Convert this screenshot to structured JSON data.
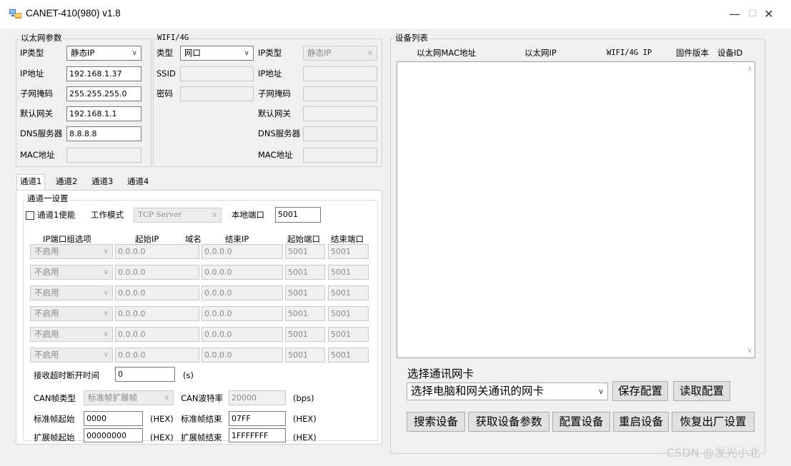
{
  "window": {
    "title": "CANET-410(980) v1.8",
    "min": "—",
    "max": "☐",
    "close": "✕"
  },
  "ethernet": {
    "group_label": "以太网参数",
    "ip_type_label": "IP类型",
    "ip_type_value": "静态IP",
    "ip_label": "IP地址",
    "ip_value": "192.168.1.37",
    "mask_label": "子网掩码",
    "mask_value": "255.255.255.0",
    "gateway_label": "默认网关",
    "gateway_value": "192.168.1.1",
    "dns_label": "DNS服务器",
    "dns_value": "8.8.8.8",
    "mac_label": "MAC地址",
    "mac_value": ""
  },
  "wifi": {
    "group_label": "WIFI/4G",
    "type_label": "类型",
    "type_value": "网口",
    "ssid_label": "SSID",
    "pwd_label": "密码",
    "ip_type_label": "IP类型",
    "ip_type_value": "静态IP",
    "ip_label": "IP地址",
    "mask_label": "子网掩码",
    "gateway_label": "默认网关",
    "dns_label": "DNS服务器",
    "mac_label": "MAC地址"
  },
  "tabs": [
    "通道1",
    "通道2",
    "通道3",
    "通道4"
  ],
  "channel": {
    "group_label": "通道一设置",
    "enable_label": "通道1使能",
    "mode_label": "工作模式",
    "mode_value": "TCP Server",
    "port_label": "本地端口",
    "port_value": "5001",
    "headers": {
      "group": "IP端口组选项",
      "start_ip": "起始IP",
      "domain": "域名",
      "end_ip": "结束IP",
      "start_port": "起始端口",
      "end_port": "结束端口"
    },
    "rows": [
      {
        "opt": "不启用",
        "start_ip": "0.0.0.0",
        "end_ip": "0.0.0.0",
        "start_port": "5001",
        "end_port": "5001"
      },
      {
        "opt": "不启用",
        "start_ip": "0.0.0.0",
        "end_ip": "0.0.0.0",
        "start_port": "5001",
        "end_port": "5001"
      },
      {
        "opt": "不启用",
        "start_ip": "0.0.0.0",
        "end_ip": "0.0.0.0",
        "start_port": "5001",
        "end_port": "5001"
      },
      {
        "opt": "不启用",
        "start_ip": "0.0.0.0",
        "end_ip": "0.0.0.0",
        "start_port": "5001",
        "end_port": "5001"
      },
      {
        "opt": "不启用",
        "start_ip": "0.0.0.0",
        "end_ip": "0.0.0.0",
        "start_port": "5001",
        "end_port": "5001"
      },
      {
        "opt": "不启用",
        "start_ip": "0.0.0.0",
        "end_ip": "0.0.0.0",
        "start_port": "5001",
        "end_port": "5001"
      }
    ],
    "timeout_label": "接收超时断开时间",
    "timeout_value": "0",
    "timeout_unit": "(s)",
    "can_type_label": "CAN帧类型",
    "can_type_value": "标准帧扩展帧",
    "baud_label": "CAN波特率",
    "baud_value": "20000",
    "baud_unit": "(bps)",
    "std_start_label": "标准帧起始",
    "std_start_value": "0000",
    "std_end_label": "标准帧结束",
    "std_end_value": "07FF",
    "ext_start_label": "扩展帧起始",
    "ext_start_value": "00000000",
    "ext_end_label": "扩展帧结束",
    "ext_end_value": "1FFFFFFF",
    "hex": "(HEX)"
  },
  "devices": {
    "group_label": "设备列表",
    "columns": [
      "以太网MAC地址",
      "以太网IP",
      "WIFI/4G IP",
      "固件版本",
      "设备ID"
    ]
  },
  "nic": {
    "label": "选择通讯网卡",
    "value": "选择电脑和网关通讯的网卡",
    "save": "保存配置",
    "read": "读取配置"
  },
  "actions": {
    "search": "搜索设备",
    "get_params": "获取设备参数",
    "config": "配置设备",
    "restart": "重启设备",
    "factory": "恢复出厂设置"
  },
  "watermark": "CSDN @发光小北"
}
